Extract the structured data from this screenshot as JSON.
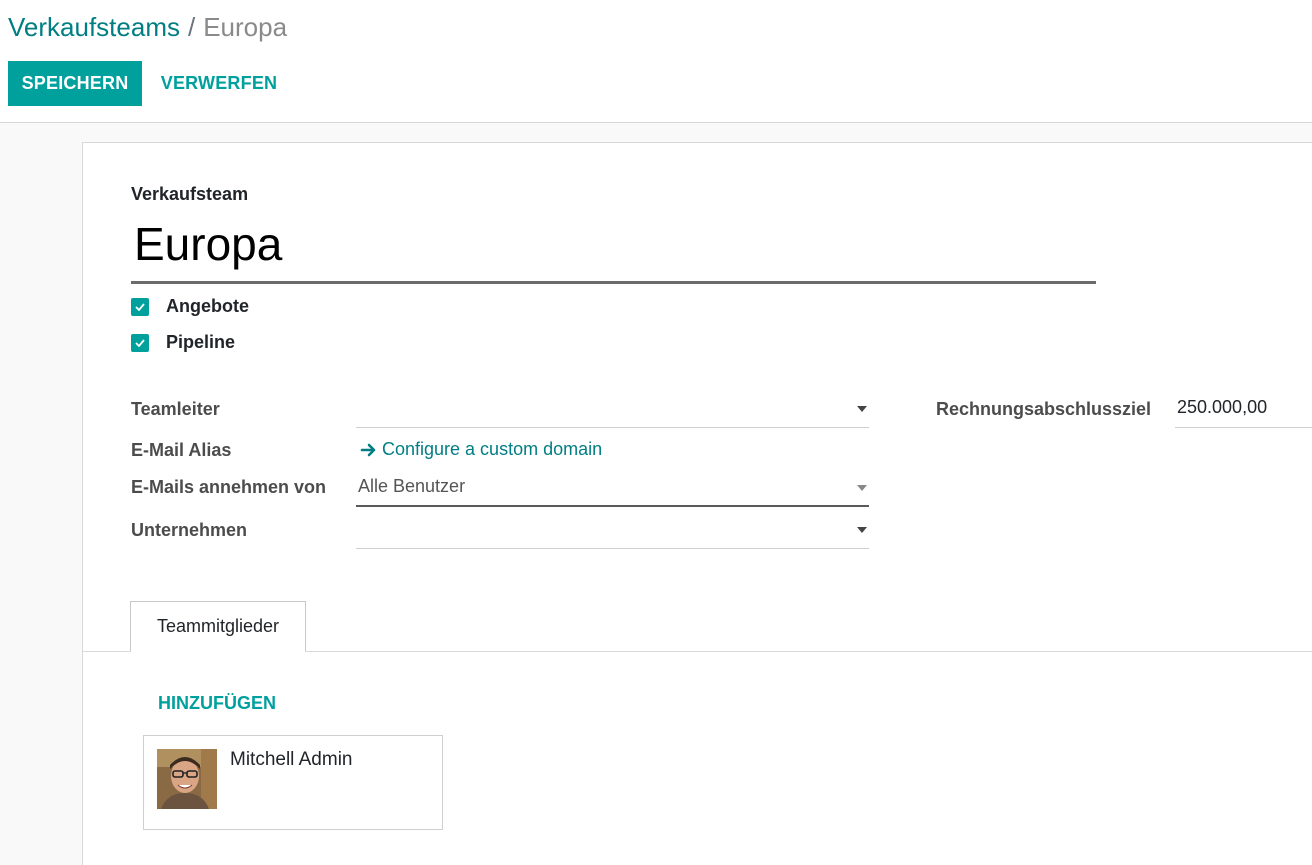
{
  "breadcrumb": {
    "parent": "Verkaufsteams",
    "separator": "/",
    "current": "Europa"
  },
  "toolbar": {
    "save_label": "SPEICHERN",
    "discard_label": "VERWERFEN"
  },
  "form": {
    "name_label": "Verkaufsteam",
    "name_value": "Europa",
    "checkboxes": [
      {
        "label": "Angebote",
        "checked": true
      },
      {
        "label": "Pipeline",
        "checked": true
      }
    ],
    "fields": {
      "team_leader": {
        "label": "Teamleiter",
        "value": ""
      },
      "email_alias": {
        "label": "E-Mail Alias",
        "link": "Configure a custom domain"
      },
      "accept_emails": {
        "label": "E-Mails annehmen von",
        "value": "Alle Benutzer"
      },
      "company": {
        "label": "Unternehmen",
        "value": ""
      },
      "invoice_target": {
        "label": "Rechnungsabschlussziel",
        "value": "250.000,00"
      }
    }
  },
  "tabs": [
    {
      "label": "Teammitglieder",
      "active": true
    }
  ],
  "members": {
    "add_label": "HINZUFÜGEN",
    "items": [
      {
        "name": "Mitchell Admin"
      }
    ]
  },
  "colors": {
    "accent": "#00a09d",
    "link": "#017e84"
  },
  "icons": {
    "checkbox": "checkmark-icon",
    "alias": "arrow-right-icon",
    "dropdown": "caret-down-icon"
  }
}
